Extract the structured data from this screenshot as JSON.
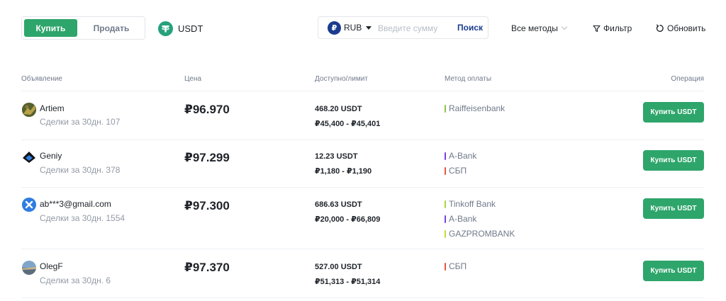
{
  "toolbar": {
    "buy_tab": "Купить",
    "sell_tab": "Продать",
    "coin": "USDT",
    "currency": "RUB",
    "amount_placeholder": "Введите сумму",
    "search_label": "Поиск",
    "methods_label": "Все методы",
    "filter_label": "Фильтр",
    "refresh_label": "Обновить"
  },
  "colors": {
    "accent_green": "#2ea56b",
    "rub_blue": "#1a3c8f",
    "tether_green": "#26a17b"
  },
  "table": {
    "headers": {
      "advertiser": "Объявление",
      "price": "Цена",
      "available": "Доступно/лимит",
      "payment": "Метод оплаты",
      "operation": "Операция"
    },
    "rows": [
      {
        "name": "Artiem",
        "deals": "Сделки за 30дн. 107",
        "price": "₽96.970",
        "available": "468.20 USDT",
        "limit": "₽45,400 - ₽45,401",
        "methods": [
          {
            "label": "Raiffeisenbank",
            "color": "#8bc34a"
          }
        ],
        "button": "Купить USDT"
      },
      {
        "name": "Geniy",
        "deals": "Сделки за 30дн. 378",
        "price": "₽97.299",
        "available": "12.23 USDT",
        "limit": "₽1,180 - ₽1,190",
        "methods": [
          {
            "label": "A-Bank",
            "color": "#7b3fe4"
          },
          {
            "label": "СБП",
            "color": "#e8553d"
          }
        ],
        "button": "Купить USDT"
      },
      {
        "name": "ab***3@gmail.com",
        "deals": "Сделки за 30дн. 1554",
        "price": "₽97.300",
        "available": "686.63 USDT",
        "limit": "₽20,000 - ₽66,809",
        "methods": [
          {
            "label": "Tinkoff Bank",
            "color": "#a5d63f"
          },
          {
            "label": "A-Bank",
            "color": "#7b3fe4"
          },
          {
            "label": "GAZPROMBANK",
            "color": "#c6d93a"
          }
        ],
        "button": "Купить USDT"
      },
      {
        "name": "OlegF",
        "deals": "Сделки за 30дн. 6",
        "price": "₽97.370",
        "available": "527.00 USDT",
        "limit": "₽51,313 - ₽51,314",
        "methods": [
          {
            "label": "СБП",
            "color": "#e8553d"
          }
        ],
        "button": "Купить USDT"
      }
    ]
  }
}
